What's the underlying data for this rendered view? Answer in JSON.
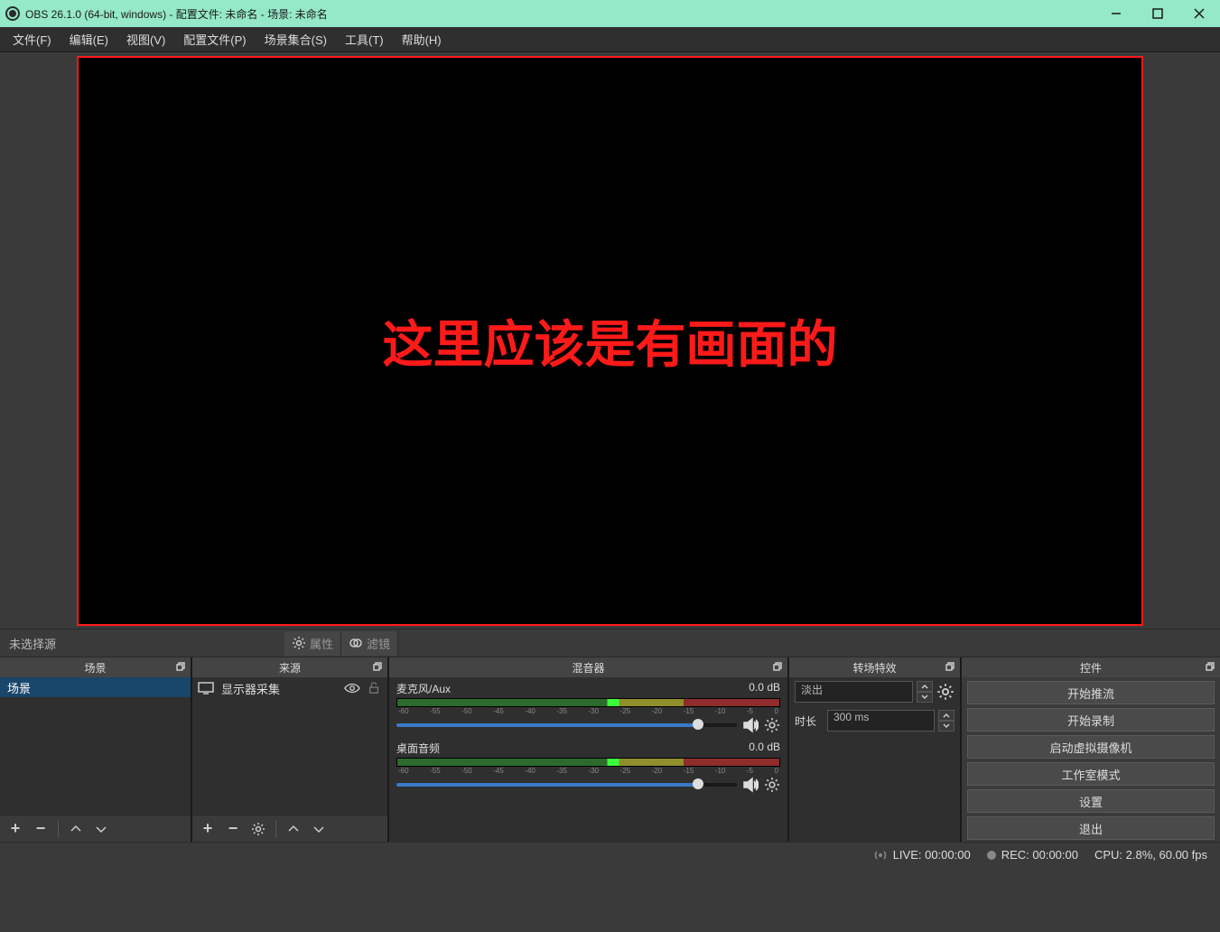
{
  "titlebar": {
    "text": "OBS 26.1.0 (64-bit, windows) - 配置文件: 未命名 - 场景: 未命名"
  },
  "menubar": {
    "items": [
      "文件(F)",
      "编辑(E)",
      "视图(V)",
      "配置文件(P)",
      "场景集合(S)",
      "工具(T)",
      "帮助(H)"
    ]
  },
  "preview": {
    "overlay_text": "这里应该是有画面的"
  },
  "source_toolbar": {
    "no_selection": "未选择源",
    "properties_btn": "属性",
    "filters_btn": "滤镜"
  },
  "docks": {
    "scenes": {
      "title": "场景",
      "items": [
        "场景"
      ]
    },
    "sources": {
      "title": "来源",
      "items": [
        {
          "name": "显示器采集"
        }
      ]
    },
    "mixer": {
      "title": "混音器",
      "channels": [
        {
          "name": "麦克风/Aux",
          "db": "0.0 dB"
        },
        {
          "name": "桌面音频",
          "db": "0.0 dB"
        }
      ],
      "ticks": [
        "-60",
        "-55",
        "-50",
        "-45",
        "-40",
        "-35",
        "-30",
        "-25",
        "-20",
        "-15",
        "-10",
        "-5",
        "0"
      ]
    },
    "transitions": {
      "title": "转场特效",
      "selected": "淡出",
      "duration_label": "时长",
      "duration_value": "300 ms"
    },
    "controls": {
      "title": "控件",
      "buttons": [
        "开始推流",
        "开始录制",
        "启动虚拟摄像机",
        "工作室模式",
        "设置",
        "退出"
      ]
    }
  },
  "statusbar": {
    "live": "LIVE: 00:00:00",
    "rec": "REC: 00:00:00",
    "cpu": "CPU: 2.8%, 60.00 fps"
  }
}
